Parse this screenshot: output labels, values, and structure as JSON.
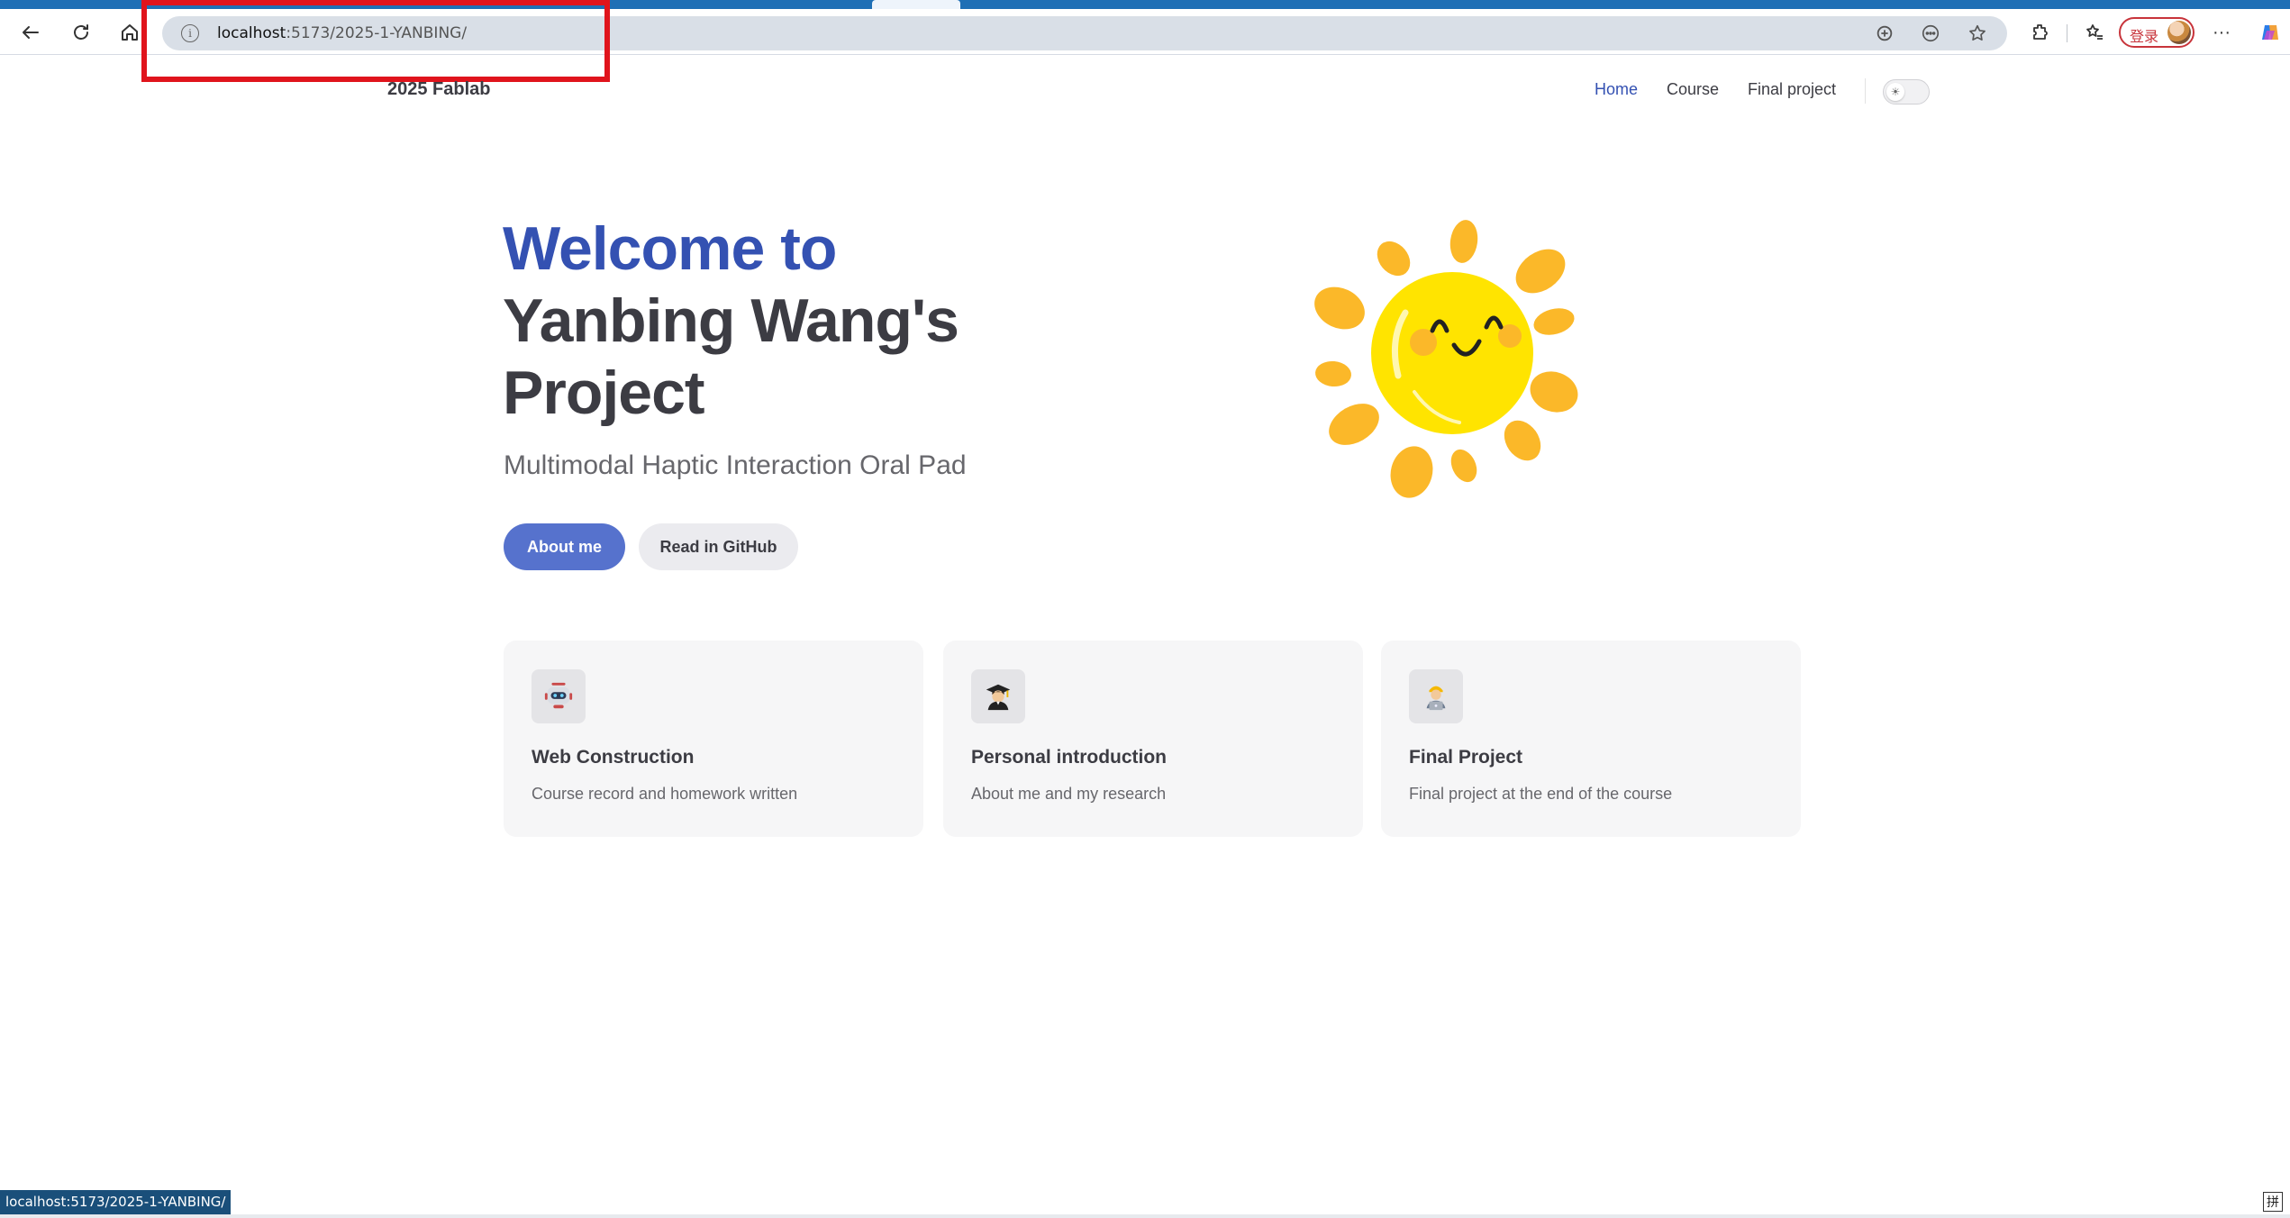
{
  "browser": {
    "url_host": "localhost",
    "url_path": ":5173/2025-1-YANBING/",
    "login_label": "登录",
    "status_url": "localhost:5173/2025-1-YANBING/",
    "ime_label": "拼",
    "more_label": "···"
  },
  "site": {
    "title": "2025 Fablab",
    "nav": [
      {
        "label": "Home",
        "active": true
      },
      {
        "label": "Course",
        "active": false
      },
      {
        "label": "Final project",
        "active": false
      }
    ],
    "appearance_icon": "sun-icon"
  },
  "hero": {
    "name_line1": "Welcome to",
    "name_line2": "Yanbing Wang's",
    "name_line3": "Project",
    "tagline": "Multimodal Haptic Interaction Oral Pad",
    "actions": [
      {
        "label": "About me",
        "theme": "brand"
      },
      {
        "label": "Read in GitHub",
        "theme": "alt"
      }
    ],
    "image": "smiling-sun-illustration"
  },
  "features": [
    {
      "icon": "robot-icon",
      "title": "Web Construction",
      "details": "Course record and homework written"
    },
    {
      "icon": "graduate-icon",
      "title": "Personal introduction",
      "details": "About me and my research"
    },
    {
      "icon": "worker-icon",
      "title": "Final Project",
      "details": "Final project at the end of the course"
    }
  ],
  "colors": {
    "brand": "#3451b2",
    "brand_button": "#5672cd",
    "text": "#3c3c43",
    "highlight": "#e0141c",
    "sun_yellow": "#ffe400",
    "sun_ray": "#fbb829"
  }
}
